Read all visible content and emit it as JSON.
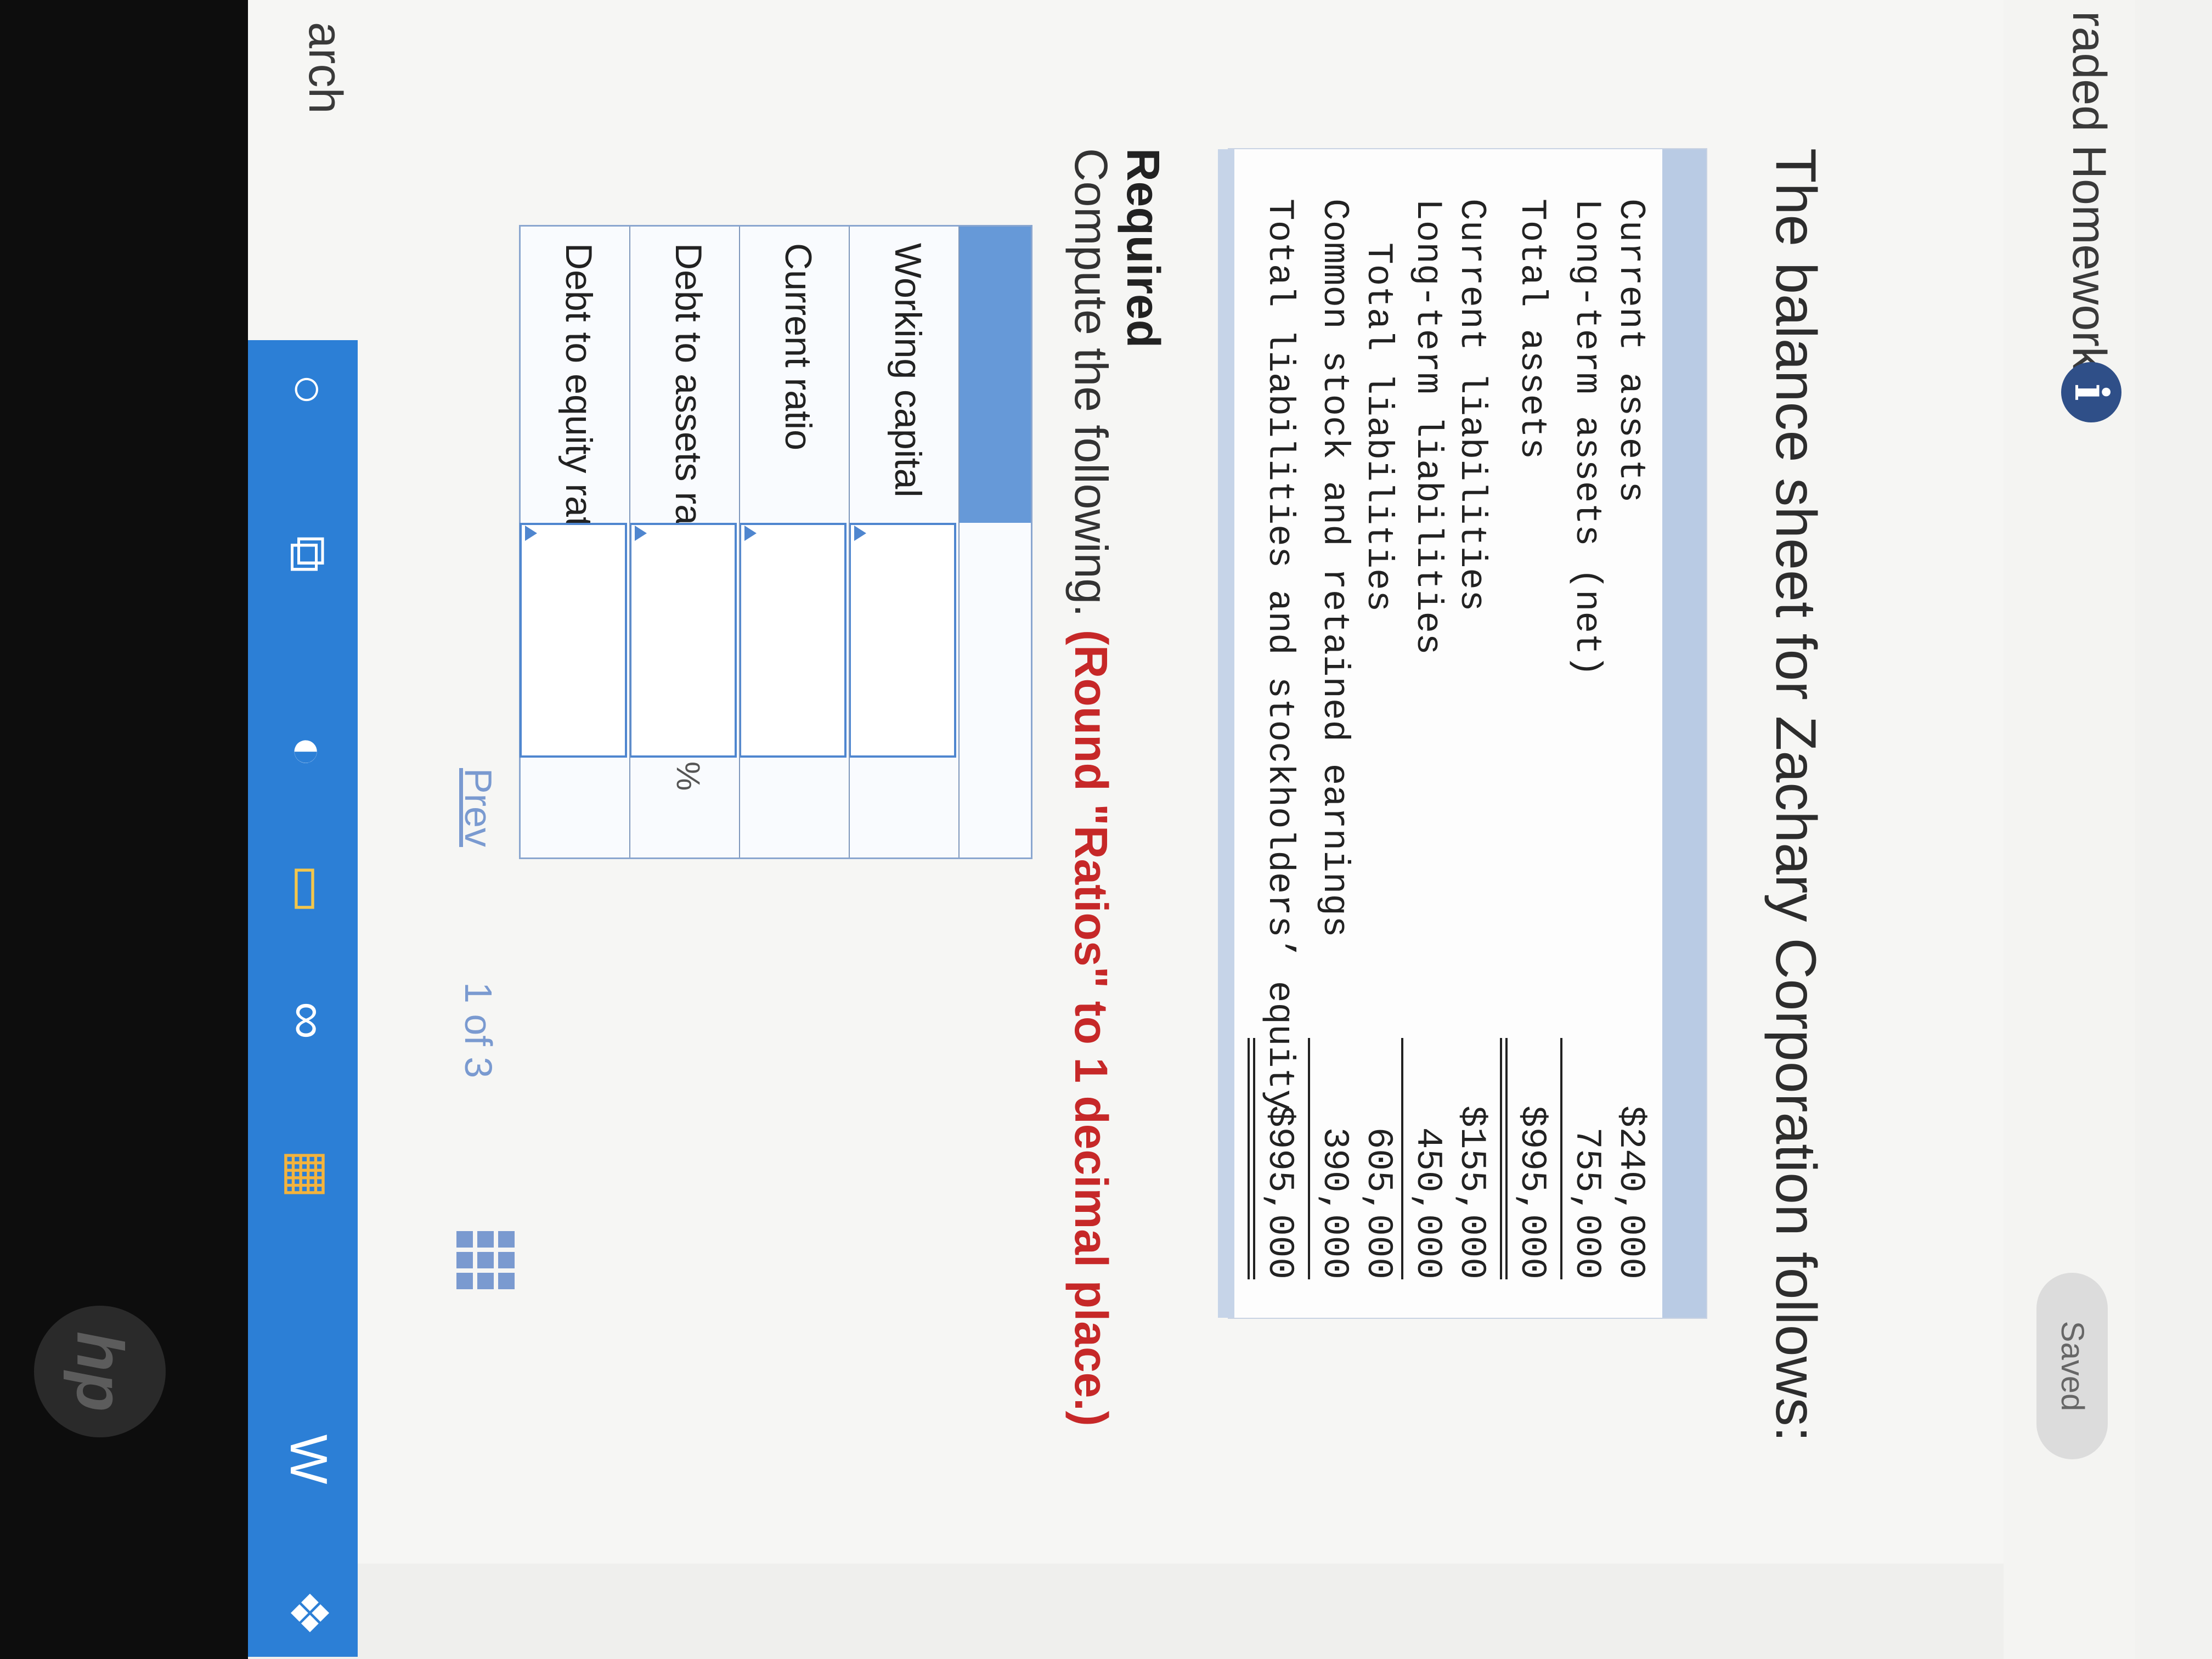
{
  "header": {
    "app_title": "raded Homework",
    "info_icon": "i",
    "saved_label": "Saved"
  },
  "intro": "The balance sheet for Zachary Corporation follows:",
  "balance_sheet": {
    "rows": [
      {
        "label": "Current assets",
        "value": "$240,000"
      },
      {
        "label": "Long-term assets (net)",
        "value": "755,000"
      },
      {
        "label": "Total assets",
        "value": "$995,000"
      },
      {
        "label": "Current liabilities",
        "value": "$155,000"
      },
      {
        "label": "Long-term liabilities",
        "value": "450,000"
      },
      {
        "label": "Total liabilities",
        "value": "605,000"
      },
      {
        "label": "Common stock and retained earnings",
        "value": "390,000"
      },
      {
        "label": "Total liabilities and stockholders’ equity",
        "value": "$995,000"
      }
    ]
  },
  "required": {
    "heading": "Required",
    "text": "Compute the following.",
    "note": "(Round \"Ratios\" to 1 decimal place.)"
  },
  "answer_table": {
    "rows": [
      {
        "label": "Working capital",
        "suffix": ""
      },
      {
        "label": "Current ratio",
        "suffix": ""
      },
      {
        "label": "Debt to assets ratio",
        "suffix": "%"
      },
      {
        "label": "Debt to equity ratio",
        "suffix": ""
      }
    ]
  },
  "pager": {
    "prev": "Prev",
    "count": "1 of 3"
  },
  "taskbar": {
    "search": "arch",
    "icons": [
      "cortana-icon",
      "task-view-icon",
      "edge-icon",
      "file-explorer-icon",
      "infinity-icon",
      "store-icon",
      "word-icon",
      "dropbox-icon"
    ]
  },
  "colors": {
    "accent": "#2c7fd6",
    "table_header": "#6699d8",
    "note_red": "#c62828"
  }
}
